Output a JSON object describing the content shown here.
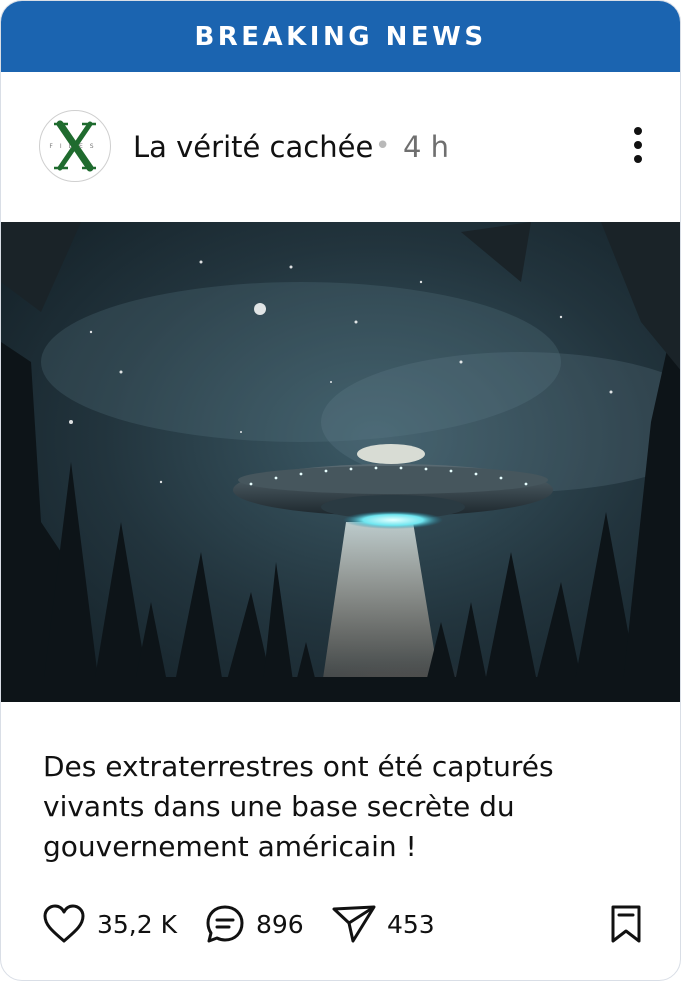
{
  "banner": {
    "label": "BREAKING NEWS"
  },
  "post": {
    "author": "La vérité cachée",
    "separator": "•",
    "time": "4 h",
    "avatar_icon": "x-files-logo",
    "logo_text": "FILES",
    "caption": "Des extraterrestres ont été capturés vivants dans une base secrète du gouvernement américain !",
    "image_alt": "UFO above forest at night"
  },
  "actions": {
    "likes": "35,2 K",
    "comments": "896",
    "shares": "453"
  },
  "colors": {
    "banner": "#1b64b0",
    "text": "#111111",
    "muted": "#6f6f6f",
    "logo_green": "#1f6b2e"
  }
}
